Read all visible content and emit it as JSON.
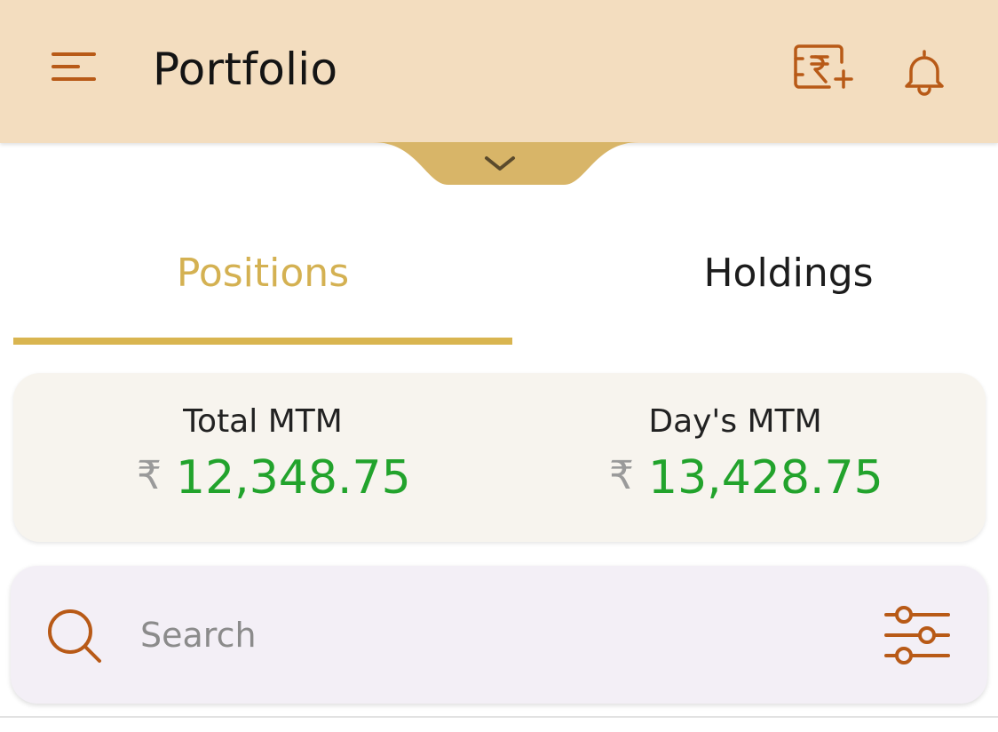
{
  "header": {
    "title": "Portfolio",
    "icons": [
      "menu-icon",
      "add-funds-rupee-icon",
      "notification-bell-icon"
    ],
    "accent_color": "#b85a17",
    "background_color": "#f3ddbf"
  },
  "pull_tab": {
    "icon": "chevron-down-icon"
  },
  "tabs": [
    {
      "label": "Positions",
      "active": true,
      "color": "#d4b152"
    },
    {
      "label": "Holdings",
      "active": false
    }
  ],
  "mtm": {
    "currency_symbol": "₹",
    "total": {
      "label": "Total MTM",
      "value": "12,348.75"
    },
    "day": {
      "label": "Day's MTM",
      "value": "13,428.75"
    },
    "value_color": "#22a32c"
  },
  "search": {
    "placeholder": "Search",
    "value": "",
    "icon": "search-icon",
    "filter_icon": "filter-sliders-icon"
  }
}
